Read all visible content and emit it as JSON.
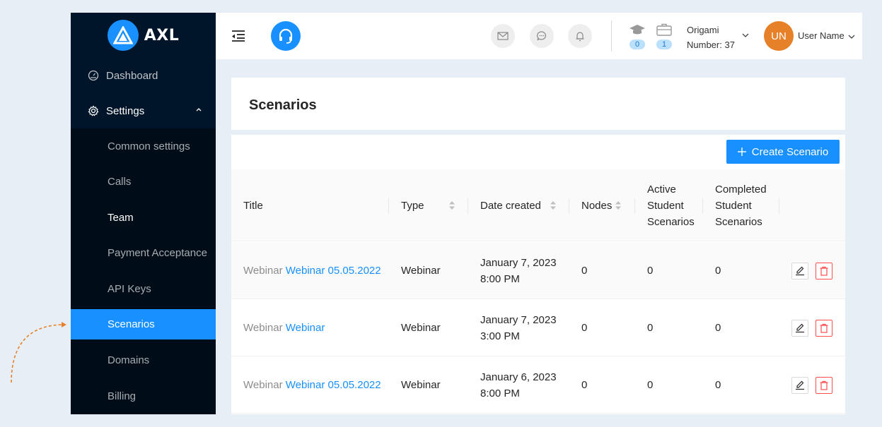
{
  "brand": {
    "name": "AXL"
  },
  "sidebar": {
    "dashboard": "Dashboard",
    "settings": "Settings",
    "submenu": [
      {
        "label": "Common settings"
      },
      {
        "label": "Calls"
      },
      {
        "label": "Team"
      },
      {
        "label": "Payment Acceptance"
      },
      {
        "label": "API Keys"
      },
      {
        "label": "Scenarios",
        "active": true
      },
      {
        "label": "Domains"
      },
      {
        "label": "Billing"
      }
    ]
  },
  "header": {
    "icons": [
      "menu-fold-icon",
      "headset-icon",
      "mail-icon",
      "chat-icon",
      "bell-icon",
      "graduation-cap-icon",
      "briefcase-icon"
    ],
    "students_count": "0",
    "cases_count": "1",
    "org_name": "Origami",
    "org_number": "Number: 37",
    "avatar_initials": "UN",
    "user_name": "User Name"
  },
  "page": {
    "title": "Scenarios",
    "create_button": "Create Scenario"
  },
  "table": {
    "columns": {
      "title": "Title",
      "type": "Type",
      "date_created": "Date created",
      "nodes": "Nodes",
      "active_1": "Active",
      "active_2": "Student",
      "active_3": "Scenarios",
      "completed_1": "Completed",
      "completed_2": "Student",
      "completed_3": "Scenarios"
    },
    "rows": [
      {
        "prefix": "Webinar",
        "name": "Webinar 05.05.2022",
        "type": "Webinar",
        "date": "January 7, 2023",
        "time": "8:00 PM",
        "nodes": "0",
        "active": "0",
        "completed": "0"
      },
      {
        "prefix": "Webinar",
        "name": "Webinar",
        "type": "Webinar",
        "date": "January 7, 2023",
        "time": "3:00 PM",
        "nodes": "0",
        "active": "0",
        "completed": "0"
      },
      {
        "prefix": "Webinar",
        "name": "Webinar 05.05.2022",
        "type": "Webinar",
        "date": "January 6, 2023",
        "time": "8:00 PM",
        "nodes": "0",
        "active": "0",
        "completed": "0"
      }
    ]
  },
  "colors": {
    "sidebar_bg": "#001529",
    "submenu_bg": "#000c17",
    "primary": "#1890ff",
    "avatar": "#e6812a",
    "danger": "#ff4d4f",
    "annotation_arrow": "#e6812a"
  }
}
